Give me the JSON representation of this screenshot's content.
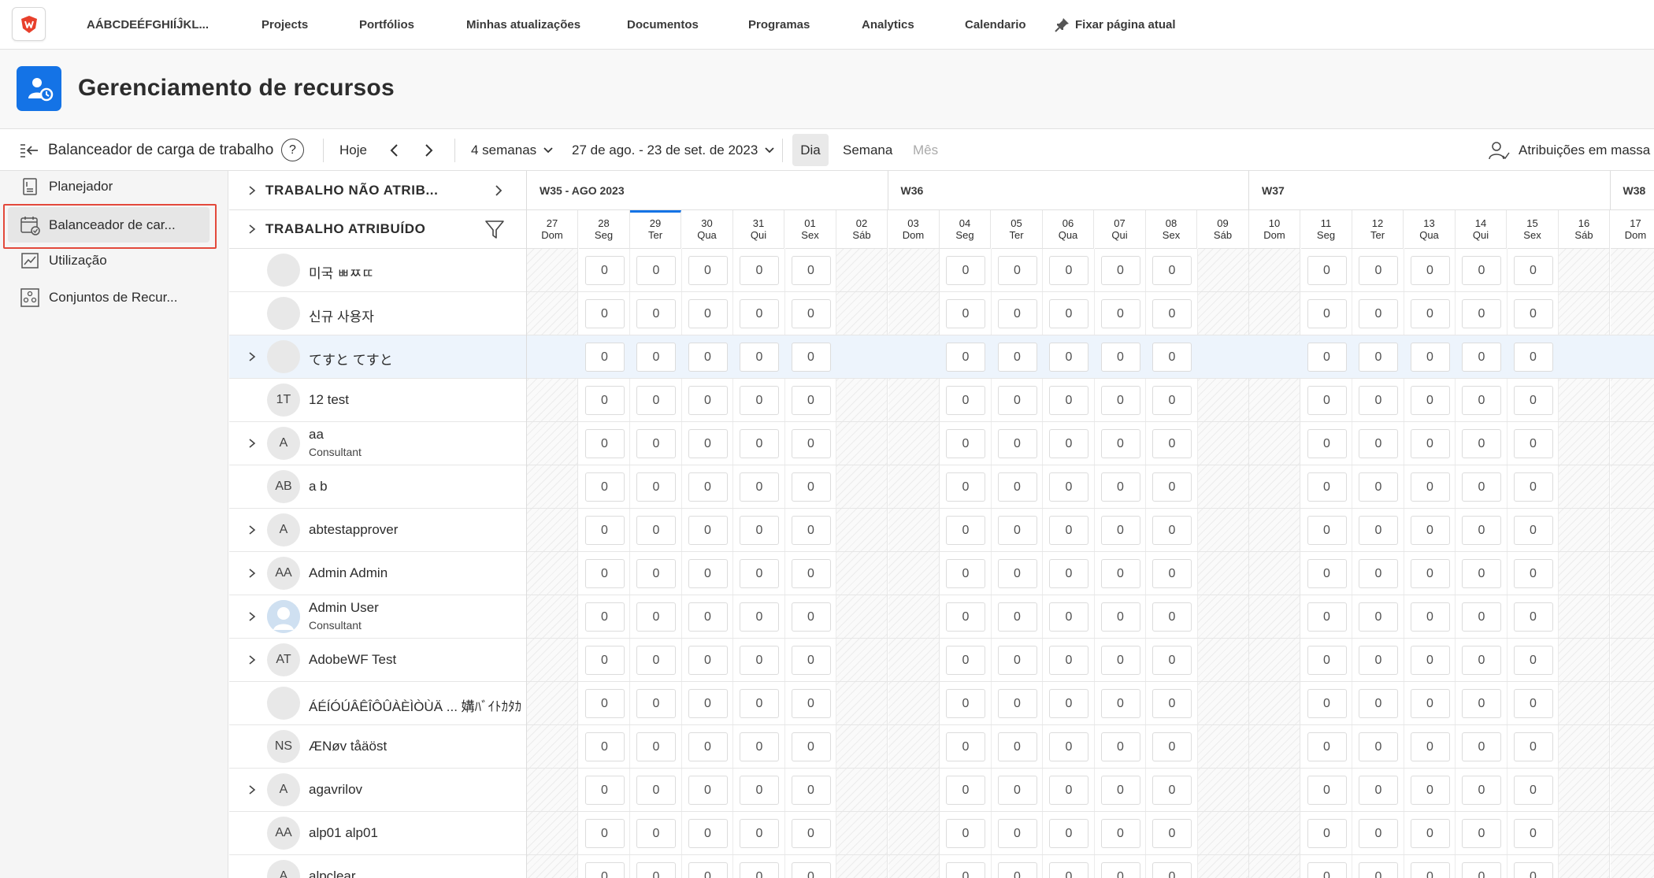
{
  "nav": {
    "org": "AÁBCDEÉFGHIÍĴKL...",
    "items": [
      "Projects",
      "Portfólios",
      "Minhas atualizações",
      "Documentos",
      "Programas",
      "Analytics",
      "Calendario"
    ],
    "pin": "Fixar página atual"
  },
  "header": {
    "title": "Gerenciamento de recursos"
  },
  "toolbar": {
    "tool_name": "Balanceador de carga de trabalho",
    "help": "?",
    "today": "Hoje",
    "range_select": "4 semanas",
    "date_range": "27 de ago. - 23 de set. de 2023",
    "views": [
      "Dia",
      "Semana",
      "Mês"
    ],
    "bulk": "Atribuições em massa"
  },
  "sidebar": {
    "items": [
      "Planejador",
      "Balanceador de car...",
      "Utilização",
      "Conjuntos de Recur..."
    ]
  },
  "sections": {
    "unassigned": "TRABALHO NÃO ATRIB...",
    "assigned": "TRABALHO ATRIBUÍDO"
  },
  "weeks": [
    "W35 - AGO 2023",
    "W36",
    "W37",
    "W38"
  ],
  "days": [
    {
      "num": "27",
      "dow": "Dom"
    },
    {
      "num": "28",
      "dow": "Seg"
    },
    {
      "num": "29",
      "dow": "Ter"
    },
    {
      "num": "30",
      "dow": "Qua"
    },
    {
      "num": "31",
      "dow": "Qui"
    },
    {
      "num": "01",
      "dow": "Sex"
    },
    {
      "num": "02",
      "dow": "Sáb"
    },
    {
      "num": "03",
      "dow": "Dom"
    },
    {
      "num": "04",
      "dow": "Seg"
    },
    {
      "num": "05",
      "dow": "Ter"
    },
    {
      "num": "06",
      "dow": "Qua"
    },
    {
      "num": "07",
      "dow": "Qui"
    },
    {
      "num": "08",
      "dow": "Sex"
    },
    {
      "num": "09",
      "dow": "Sáb"
    },
    {
      "num": "10",
      "dow": "Dom"
    },
    {
      "num": "11",
      "dow": "Seg"
    },
    {
      "num": "12",
      "dow": "Ter"
    },
    {
      "num": "13",
      "dow": "Qua"
    },
    {
      "num": "14",
      "dow": "Qui"
    },
    {
      "num": "15",
      "dow": "Sex"
    },
    {
      "num": "16",
      "dow": "Sáb"
    },
    {
      "num": "17",
      "dow": "Dom"
    }
  ],
  "today_index": 2,
  "cell_value": "0",
  "users": [
    {
      "avatar": "",
      "name": "미국 ㅃㅉㄸ",
      "role": "",
      "expand": false
    },
    {
      "avatar": "",
      "name": "신규 사용자",
      "role": "",
      "expand": false
    },
    {
      "avatar": "",
      "name": "てすと てすと",
      "role": "",
      "expand": true,
      "highlight": true
    },
    {
      "avatar": "1T",
      "name": "12 test",
      "role": "",
      "expand": false
    },
    {
      "avatar": "A",
      "name": "aa",
      "role": "Consultant",
      "expand": true
    },
    {
      "avatar": "AB",
      "name": "a b",
      "role": "",
      "expand": false
    },
    {
      "avatar": "A",
      "name": "abtestapprover",
      "role": "",
      "expand": true
    },
    {
      "avatar": "AA",
      "name": "Admin Admin",
      "role": "",
      "expand": true
    },
    {
      "avatar": "photo",
      "name": "Admin User",
      "role": "Consultant",
      "expand": true
    },
    {
      "avatar": "AT",
      "name": "AdobeWF Test",
      "role": "",
      "expand": true
    },
    {
      "avatar": "",
      "name": "ÁÉÍÓÚÂÊÎÔÛÀÈÌÒÙÄ ... 媾ﾊﾞｲﾄｶﾀｶ",
      "role": "",
      "expand": false
    },
    {
      "avatar": "NS",
      "name": "ÆNøv tåäöst",
      "role": "",
      "expand": false
    },
    {
      "avatar": "A",
      "name": "agavrilov",
      "role": "",
      "expand": true
    },
    {
      "avatar": "AA",
      "name": "alp01 alp01",
      "role": "",
      "expand": false
    },
    {
      "avatar": "A",
      "name": "alpclear",
      "role": "",
      "expand": false
    }
  ],
  "colors": {
    "accent": "#1473e6",
    "highlight_border": "#e3493b",
    "row_highlight": "#edf4fc"
  }
}
